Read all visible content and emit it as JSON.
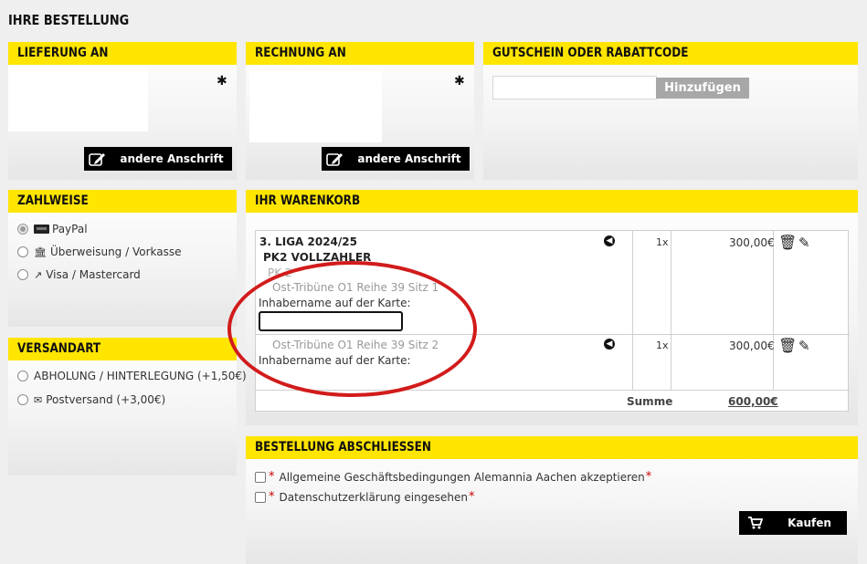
{
  "page": {
    "title": "IHRE BESTELLUNG"
  },
  "delivery": {
    "heading": "LIEFERUNG AN",
    "button_label": "andere Anschrift"
  },
  "billing": {
    "heading": "RECHNUNG AN",
    "button_label": "andere Anschrift"
  },
  "coupon": {
    "heading": "GUTSCHEIN ODER RABATTCODE",
    "input_value": "",
    "button_label": "Hinzufügen"
  },
  "payment": {
    "heading": "ZAHLWEISE",
    "options": [
      {
        "label": "PayPal",
        "icon": "paypal-icon",
        "selected": true
      },
      {
        "label": "Überweisung / Vorkasse",
        "icon": "bank-icon",
        "selected": false
      },
      {
        "label": "Visa / Mastercard",
        "icon": "external-link-icon",
        "selected": false
      }
    ]
  },
  "shipping": {
    "heading": "VERSANDART",
    "options": [
      {
        "label": "ABHOLUNG / HINTERLEGUNG (+1,50€)",
        "icon": "",
        "selected": false
      },
      {
        "label": "Postversand (+3,00€)",
        "icon": "envelope-icon",
        "selected": false
      }
    ]
  },
  "cart": {
    "heading": "IHR WARENKORB",
    "event": "3. LIGA 2024/25",
    "category": "PK2 VOLLZAHLER",
    "price_group": "PK 2",
    "items": [
      {
        "seat": "Ost-Tribüne O1 Reihe 39 Sitz 1",
        "holder_label": "Inhabername auf der Karte:",
        "holder_value": "",
        "qty": "1x",
        "price": "300,00€"
      },
      {
        "seat": "Ost-Tribüne O1 Reihe 39 Sitz 2",
        "holder_label": "Inhabername auf der Karte:",
        "qty": "1x",
        "price": "300,00€"
      }
    ],
    "sum_label": "Summe",
    "sum_value": "600,00€"
  },
  "checkout": {
    "heading": "BESTELLUNG ABSCHLIESSEN",
    "required_mark": "*",
    "terms_label": "Allgemeine Geschäftsbedingungen Alemannia Aachen akzeptieren",
    "privacy_label": "Datenschutzerklärung eingesehen",
    "buy_label": "Kaufen"
  },
  "colors": {
    "accent": "#ffe500",
    "highlight": "#d21b1b"
  }
}
